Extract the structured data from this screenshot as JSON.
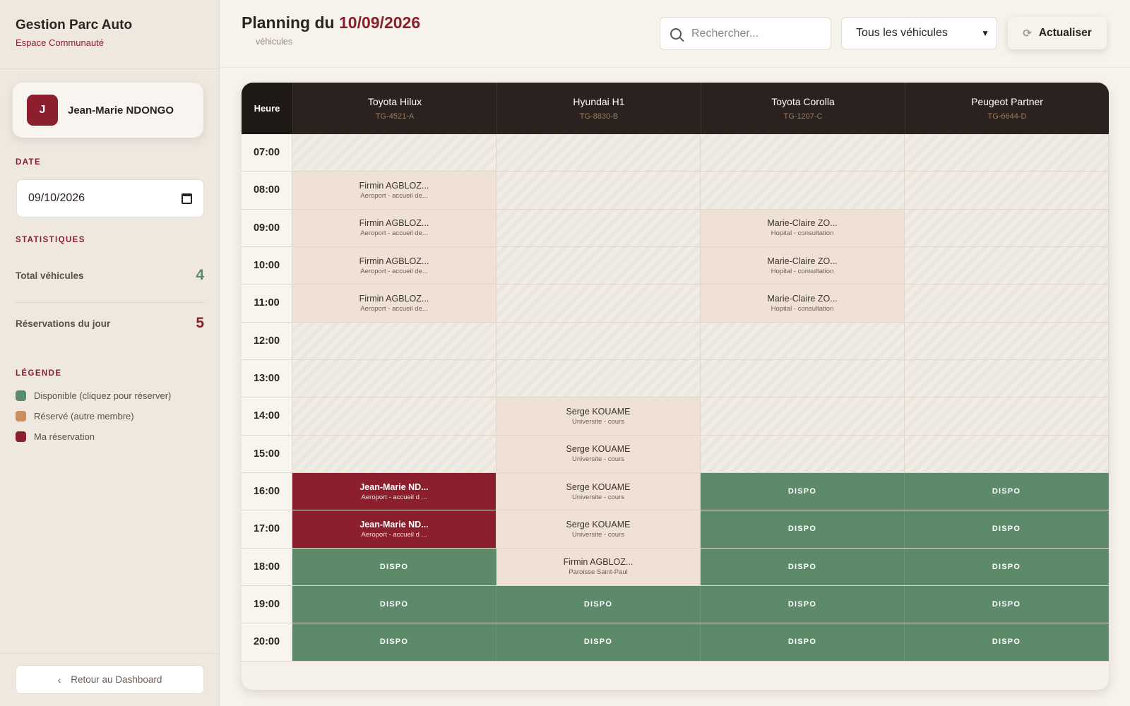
{
  "app": {
    "title": "Gestion Parc Auto",
    "subtitle": "Espace Communauté"
  },
  "user": {
    "initial": "J",
    "name": "Jean-Marie NDONGO"
  },
  "sidebar": {
    "date_label": "DATE",
    "date_value": "09/10/2026",
    "stats_label": "STATISTIQUES",
    "stats": [
      {
        "label": "Total véhicules",
        "value": "4",
        "color": "#5d8b69"
      },
      {
        "label": "Réservations du jour",
        "value": "5",
        "color": "#8b1f2e"
      }
    ],
    "legend_label": "LÉGENDE",
    "legend": [
      {
        "label": "Disponible (cliquez pour réserver)",
        "color": "#5d8b69"
      },
      {
        "label": "Réservé (autre membre)",
        "color": "#c98e63"
      },
      {
        "label": "Ma réservation",
        "color": "#8b1f2e"
      }
    ],
    "back_label": "Retour au Dashboard"
  },
  "header": {
    "title_prefix": "Planning du",
    "title_date": "10/09/2026",
    "subtitle": "véhicules",
    "search_placeholder": "Rechercher...",
    "filter_value": "Tous les véhicules",
    "refresh_label": "Actualiser"
  },
  "planning": {
    "time_header": "Heure",
    "vehicles": [
      {
        "name": "Toyota Hilux",
        "plate": "TG-4521-A"
      },
      {
        "name": "Hyundai H1",
        "plate": "TG-8830-B"
      },
      {
        "name": "Toyota Corolla",
        "plate": "TG-1207-C"
      },
      {
        "name": "Peugeot Partner",
        "plate": "TG-6644-D"
      }
    ],
    "rows": [
      {
        "time": "07:00",
        "cells": [
          {
            "s": "past"
          },
          {
            "s": "past"
          },
          {
            "s": "past"
          },
          {
            "s": "past"
          }
        ]
      },
      {
        "time": "08:00",
        "cells": [
          {
            "s": "res",
            "name": "Firmin AGBLOZ...",
            "place": "Aeroport - accueil de..."
          },
          {
            "s": "past"
          },
          {
            "s": "past"
          },
          {
            "s": "past"
          }
        ]
      },
      {
        "time": "09:00",
        "cells": [
          {
            "s": "res",
            "name": "Firmin AGBLOZ...",
            "place": "Aeroport - accueil de..."
          },
          {
            "s": "past"
          },
          {
            "s": "res",
            "name": "Marie-Claire ZO...",
            "place": "Hopital - consultation"
          },
          {
            "s": "past"
          }
        ]
      },
      {
        "time": "10:00",
        "cells": [
          {
            "s": "res",
            "name": "Firmin AGBLOZ...",
            "place": "Aeroport - accueil de..."
          },
          {
            "s": "past"
          },
          {
            "s": "res",
            "name": "Marie-Claire ZO...",
            "place": "Hopital - consultation"
          },
          {
            "s": "past"
          }
        ]
      },
      {
        "time": "11:00",
        "cells": [
          {
            "s": "res",
            "name": "Firmin AGBLOZ...",
            "place": "Aeroport - accueil de..."
          },
          {
            "s": "past"
          },
          {
            "s": "res",
            "name": "Marie-Claire ZO...",
            "place": "Hopital - consultation"
          },
          {
            "s": "past"
          }
        ]
      },
      {
        "time": "12:00",
        "cells": [
          {
            "s": "past"
          },
          {
            "s": "past"
          },
          {
            "s": "past"
          },
          {
            "s": "past"
          }
        ]
      },
      {
        "time": "13:00",
        "cells": [
          {
            "s": "past"
          },
          {
            "s": "past"
          },
          {
            "s": "past"
          },
          {
            "s": "past"
          }
        ]
      },
      {
        "time": "14:00",
        "cells": [
          {
            "s": "past"
          },
          {
            "s": "res",
            "name": "Serge KOUAME",
            "place": "Universite - cours"
          },
          {
            "s": "past"
          },
          {
            "s": "past"
          }
        ]
      },
      {
        "time": "15:00",
        "cells": [
          {
            "s": "past"
          },
          {
            "s": "res",
            "name": "Serge KOUAME",
            "place": "Universite - cours"
          },
          {
            "s": "past"
          },
          {
            "s": "past"
          }
        ]
      },
      {
        "time": "16:00",
        "cells": [
          {
            "s": "mine",
            "name": "Jean-Marie ND...",
            "place": "Aeroport - accueil d ..."
          },
          {
            "s": "res",
            "name": "Serge KOUAME",
            "place": "Universite - cours"
          },
          {
            "s": "free",
            "label": "DISPO"
          },
          {
            "s": "free",
            "label": "DISPO"
          }
        ]
      },
      {
        "time": "17:00",
        "cells": [
          {
            "s": "mine",
            "name": "Jean-Marie ND...",
            "place": "Aeroport - accueil d ..."
          },
          {
            "s": "res",
            "name": "Serge KOUAME",
            "place": "Universite - cours"
          },
          {
            "s": "free",
            "label": "DISPO"
          },
          {
            "s": "free",
            "label": "DISPO"
          }
        ]
      },
      {
        "time": "18:00",
        "cells": [
          {
            "s": "free",
            "label": "DISPO"
          },
          {
            "s": "res",
            "name": "Firmin AGBLOZ...",
            "place": "Paroisse Saint-Paul"
          },
          {
            "s": "free",
            "label": "DISPO"
          },
          {
            "s": "free",
            "label": "DISPO"
          }
        ]
      },
      {
        "time": "19:00",
        "cells": [
          {
            "s": "free",
            "label": "DISPO"
          },
          {
            "s": "free",
            "label": "DISPO"
          },
          {
            "s": "free",
            "label": "DISPO"
          },
          {
            "s": "free",
            "label": "DISPO"
          }
        ]
      },
      {
        "time": "20:00",
        "cells": [
          {
            "s": "free",
            "label": "DISPO"
          },
          {
            "s": "free",
            "label": "DISPO"
          },
          {
            "s": "free",
            "label": "DISPO"
          },
          {
            "s": "free",
            "label": "DISPO"
          }
        ]
      }
    ]
  }
}
